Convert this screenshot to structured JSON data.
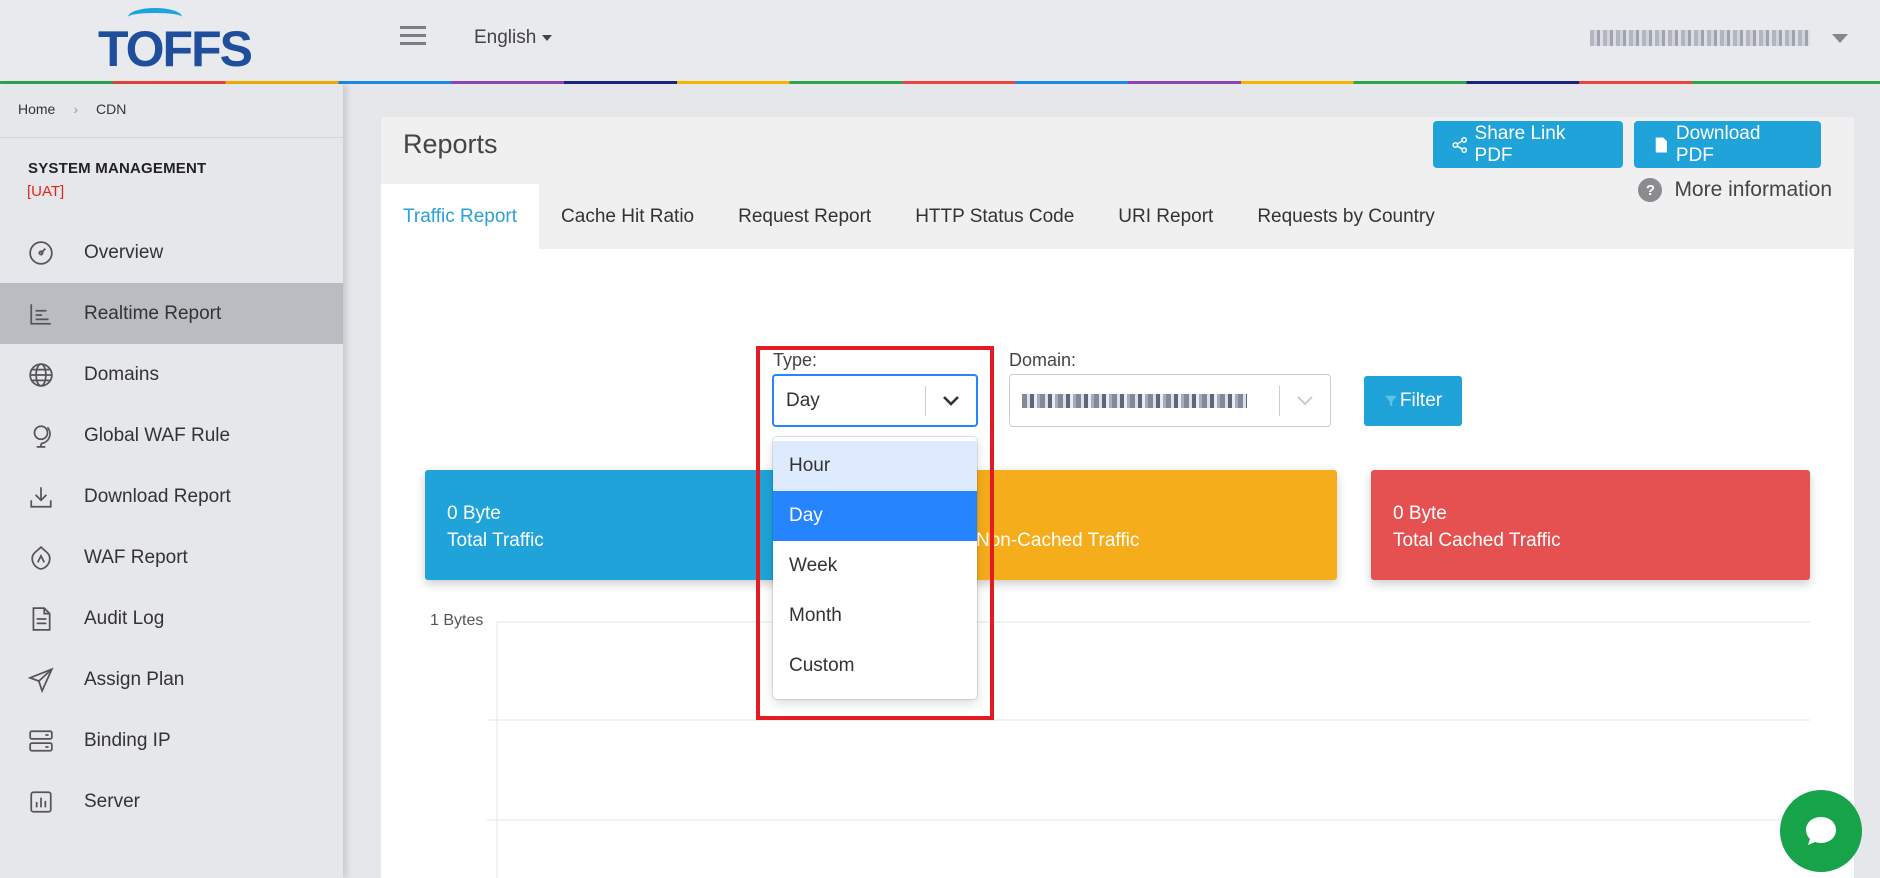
{
  "header": {
    "logo_text": "TOFFS",
    "language": "English"
  },
  "sidebar": {
    "breadcrumb": [
      "Home",
      "CDN"
    ],
    "section_title": "SYSTEM MANAGEMENT",
    "environment_tag": "[UAT]",
    "items": [
      {
        "label": "Overview",
        "icon": "gauge-icon"
      },
      {
        "label": "Realtime Report",
        "icon": "chart-icon",
        "active": true
      },
      {
        "label": "Domains",
        "icon": "globe-icon"
      },
      {
        "label": "Global WAF Rule",
        "icon": "globe-stand-icon"
      },
      {
        "label": "Download Report",
        "icon": "download-icon"
      },
      {
        "label": "WAF Report",
        "icon": "shield-icon"
      },
      {
        "label": "Audit Log",
        "icon": "document-icon"
      },
      {
        "label": "Assign Plan",
        "icon": "paper-plane-icon"
      },
      {
        "label": "Binding IP",
        "icon": "server-icon"
      },
      {
        "label": "Server",
        "icon": "bar-chart-icon"
      }
    ]
  },
  "main": {
    "title": "Reports",
    "share_button": "Share Link PDF",
    "download_button": "Download PDF",
    "tabs": [
      "Traffic Report",
      "Cache Hit Ratio",
      "Request Report",
      "HTTP Status Code",
      "URI Report",
      "Requests by Country"
    ],
    "active_tab": "Traffic Report",
    "more_info": "More information",
    "type_label": "Type:",
    "type_value": "Day",
    "domain_label": "Domain:",
    "filter_button": "Filter",
    "type_options": [
      "Hour",
      "Day",
      "Week",
      "Month",
      "Custom"
    ],
    "stats": [
      {
        "value": "0 Byte",
        "label": "Total Traffic",
        "color": "#1fa3d8"
      },
      {
        "value": "",
        "label": "Non-Cached Traffic",
        "color": "#f6ad1b"
      },
      {
        "value": "0 Byte",
        "label": "Total Cached Traffic",
        "color": "#e55150"
      }
    ],
    "chart_ylabel": "1 Bytes"
  },
  "chart_data": {
    "type": "line",
    "yticks": [
      "1 Bytes"
    ],
    "series": []
  },
  "colors": {
    "accent": "#1fa3d8",
    "highlight": "#e31b23",
    "select_focus": "#2684ff",
    "chat": "#16a34a"
  }
}
